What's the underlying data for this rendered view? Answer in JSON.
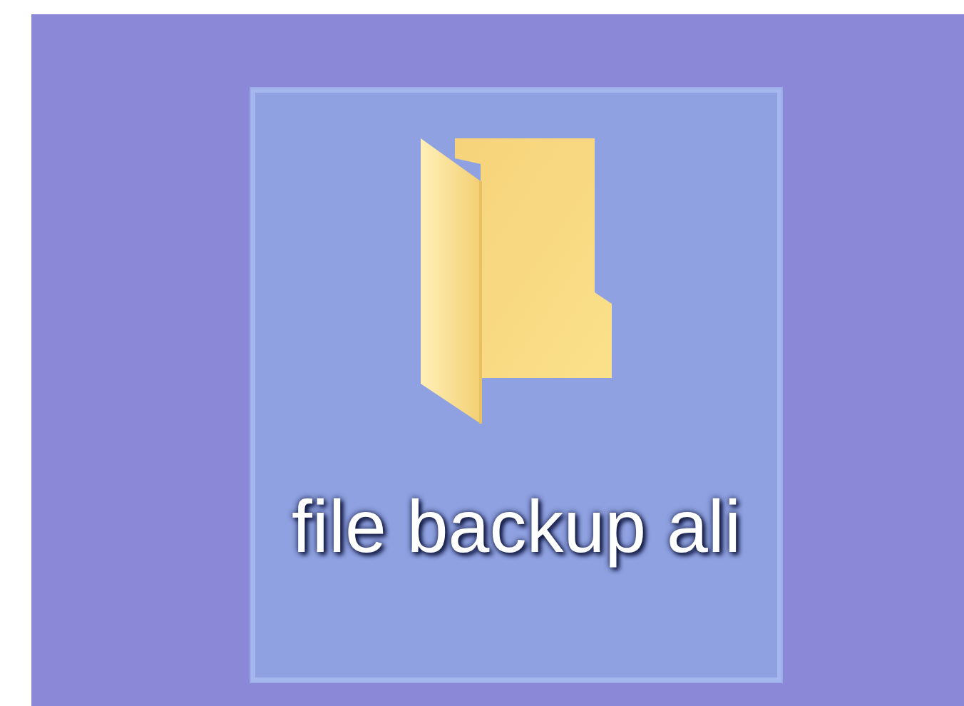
{
  "desktop": {
    "icons": [
      {
        "label": "file backup ali",
        "selected": true
      }
    ]
  }
}
